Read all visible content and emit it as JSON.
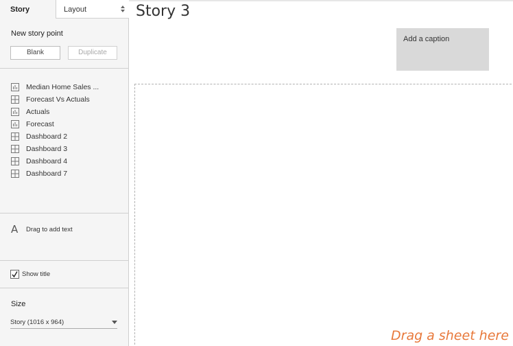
{
  "tabs": {
    "story": "Story",
    "layout": "Layout"
  },
  "new_story_point": {
    "title": "New story point",
    "blank_label": "Blank",
    "duplicate_label": "Duplicate"
  },
  "sheets": [
    {
      "label": "Median Home Sales ...",
      "icon": "bar-chart-icon"
    },
    {
      "label": "Forecast Vs Actuals",
      "icon": "dashboard-icon"
    },
    {
      "label": "Actuals",
      "icon": "bar-chart-icon"
    },
    {
      "label": "Forecast",
      "icon": "bar-chart-icon"
    },
    {
      "label": "Dashboard 2",
      "icon": "dashboard-icon"
    },
    {
      "label": "Dashboard 3",
      "icon": "dashboard-icon"
    },
    {
      "label": "Dashboard 4",
      "icon": "dashboard-icon"
    },
    {
      "label": "Dashboard 7",
      "icon": "dashboard-icon"
    }
  ],
  "text_object": {
    "glyph": "A",
    "label": "Drag to add text"
  },
  "show_title": {
    "label": "Show title",
    "checked": true
  },
  "size": {
    "title": "Size",
    "value": "Story (1016 x 964)"
  },
  "main": {
    "title": "Story 3",
    "caption_placeholder": "Add a caption",
    "drop_hint": "Drag a sheet here"
  },
  "colors": {
    "accent_orange": "#e8783a",
    "caption_bg": "#d9d9d9",
    "panel_bg": "#f5f5f5"
  }
}
